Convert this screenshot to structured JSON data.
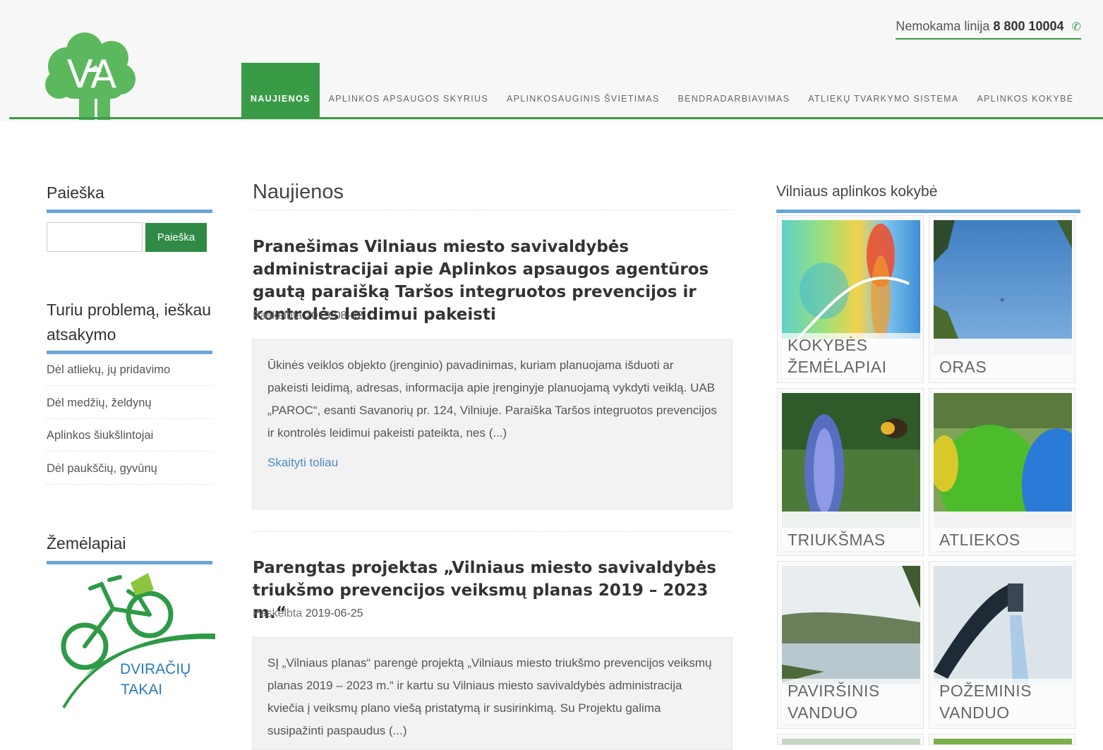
{
  "header": {
    "hotline_prefix": "Nemokama linija",
    "hotline_number": "8 800 10004",
    "phone_icon": "phone-icon",
    "logo_text": "VA",
    "accent_color": "#3a9b47"
  },
  "nav": {
    "items": [
      {
        "label": "NAUJIENOS",
        "active": true
      },
      {
        "label": "APLINKOS APSAUGOS SKYRIUS",
        "active": false
      },
      {
        "label": "APLINKOSAUGINIS ŠVIETIMAS",
        "active": false
      },
      {
        "label": "BENDRADARBIAVIMAS",
        "active": false
      },
      {
        "label": "ATLIEKŲ TVARKYMO SISTEMA",
        "active": false
      },
      {
        "label": "APLINKOS KOKYBĖ",
        "active": false
      }
    ]
  },
  "sidebar": {
    "search_title": "Paieška",
    "search_value": "",
    "search_button": "Paieška",
    "problem_title": "Turiu problemą, ieškau atsakymo",
    "links": [
      "Dėl atliekų, jų pridavimo",
      "Dėl medžių, želdynų",
      "Aplinkos šiukšlintojai",
      "Dėl paukščių, gyvūnų"
    ],
    "maps_title": "Žemėlapiai",
    "bike_logo_line1": "DVIRAČIŲ",
    "bike_logo_line2": "TAKAI"
  },
  "main": {
    "title": "Naujienos",
    "posts": [
      {
        "title": "Pranešimas Vilniaus miesto savivaldybės administracijai apie Aplinkos apsaugos agentūros gautą paraišką Taršos integruotos prevencijos ir kontrolės leidimui pakeisti",
        "meta_label": "Paskelbta",
        "date": "2019-08-02",
        "excerpt": "Ūkinės veiklos objekto (įrenginio) pavadinimas, kuriam planuojama išduoti ar pakeisti leidimą, adresas, informacija apie įrenginyje planuojamą vykdyti veiklą. UAB „PAROC“, esanti Savanorių pr. 124, Vilniuje. Paraiška Taršos integruotos prevencijos ir kontrolės leidimui pakeisti pateikta, nes (...)",
        "read_more": "Skaityti toliau"
      },
      {
        "title": "Parengtas projektas „Vilniaus miesto savivaldybės triukšmo prevencijos veiksmų planas 2019 – 2023 m.“",
        "meta_label": "Paskelbta",
        "date": "2019-06-25",
        "excerpt": "SĮ „Vilniaus planas“ parengė projektą „Vilniaus miesto triukšmo prevencijos veiksmų planas 2019 – 2023 m.“ ir kartu su Vilniaus miesto savivaldybės administracija kviečia į veiksmų plano viešą pristatymą ir susirinkimą. Su Projektu galima susipažinti paspaudus (...)"
      }
    ]
  },
  "right": {
    "title": "Vilniaus aplinkos kokybė",
    "tiles": [
      {
        "label": "KOKYBĖS ŽEMĖLAPIAI"
      },
      {
        "label": "ORAS"
      },
      {
        "label": "TRIUKŠMAS"
      },
      {
        "label": "ATLIEKOS"
      },
      {
        "label": "PAVIRŠINIS VANDUO"
      },
      {
        "label": "POŽEMINIS VANDUO"
      }
    ]
  }
}
